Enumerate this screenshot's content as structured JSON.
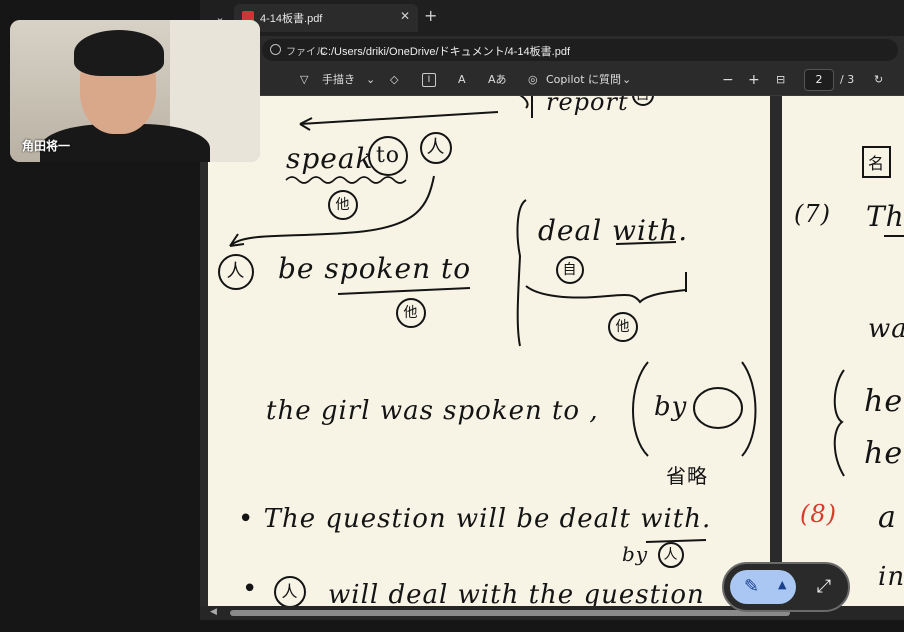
{
  "browser": {
    "tab_title": "4-14板書.pdf",
    "tab_close": "✕",
    "new_tab": "+",
    "tab_menu": "⌄"
  },
  "address": {
    "label": "ファイル",
    "url": "C:/Users/driki/OneDrive/ドキュメント/4-14板書.pdf"
  },
  "toolbar": {
    "draw_label": "手描き",
    "copilot_label": "Copilot に質問",
    "zoom_out": "−",
    "zoom_in": "+",
    "current_page": "2",
    "total_pages": "/ 3",
    "read_aloud": "Aあ",
    "text_icon": "I",
    "font_icon": "A"
  },
  "webcam": {
    "name": "角田将一"
  },
  "page1": {
    "l_report": "report",
    "l_jp_self1": "自",
    "l_speak": "speak",
    "l_to1": "to",
    "l_person1": "人",
    "l_jp_other1": "他",
    "l_person2": "人",
    "l_be_spoken_to": "be spoken to",
    "l_jp_other2": "他",
    "l_deal_with": "deal with.",
    "l_jp_self2": "自",
    "l_jp_other3": "他",
    "l_girl": "the girl was spoken to ,",
    "l_by": "by",
    "l_omit": "省略",
    "l_question": "• The question will be dealt with.",
    "l_by2": "by",
    "l_person3": "人",
    "l_last_bullet": "•",
    "l_person4": "人",
    "l_last": "will deal with the question"
  },
  "page2": {
    "l_box": "名",
    "l_7": "(7)",
    "l_th": "Th",
    "l_wa": "wa",
    "l_he1": "he",
    "l_he2": "he",
    "l_8": "(8)",
    "l_a": "a",
    "l_in": "in"
  },
  "colors": {
    "paper": "#f7f4e6",
    "ink": "#141414",
    "red_ink": "#d83a2a",
    "pen_active": "#a9c7f2"
  }
}
